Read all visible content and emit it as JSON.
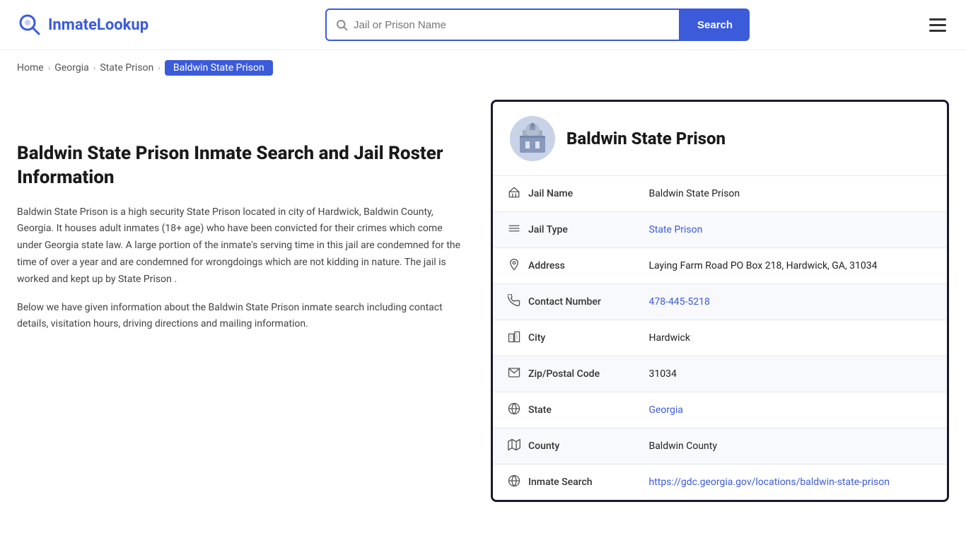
{
  "header": {
    "logo_brand": "InmateLookup",
    "logo_brand_first": "Inmate",
    "logo_brand_second": "Lookup",
    "search_placeholder": "Jail or Prison Name",
    "search_button_label": "Search"
  },
  "breadcrumb": {
    "home": "Home",
    "georgia": "Georgia",
    "state_prison": "State Prison",
    "current": "Baldwin State Prison"
  },
  "left": {
    "page_title": "Baldwin State Prison Inmate Search and Jail Roster Information",
    "description1": "Baldwin State Prison is a high security State Prison located in city of Hardwick, Baldwin County, Georgia. It houses adult inmates (18+ age) who have been convicted for their crimes which come under Georgia state law. A large portion of the inmate's serving time in this jail are condemned for the time of over a year and are condemned for wrongdoings which are not kidding in nature. The jail is worked and kept up by State Prison .",
    "description2": "Below we have given information about the Baldwin State Prison inmate search including contact details, visitation hours, driving directions and mailing information."
  },
  "card": {
    "title": "Baldwin State Prison",
    "rows": [
      {
        "icon": "🏛",
        "label": "Jail Name",
        "value": "Baldwin State Prison",
        "link": false
      },
      {
        "icon": "≡",
        "label": "Jail Type",
        "value": "State Prison",
        "link": true,
        "href": "#"
      },
      {
        "icon": "📍",
        "label": "Address",
        "value": "Laying Farm Road PO Box 218, Hardwick, GA, 31034",
        "link": false
      },
      {
        "icon": "📞",
        "label": "Contact Number",
        "value": "478-445-5218",
        "link": true,
        "href": "tel:4784455218"
      },
      {
        "icon": "🏙",
        "label": "City",
        "value": "Hardwick",
        "link": false
      },
      {
        "icon": "✉",
        "label": "Zip/Postal Code",
        "value": "31034",
        "link": false
      },
      {
        "icon": "🌐",
        "label": "State",
        "value": "Georgia",
        "link": true,
        "href": "#"
      },
      {
        "icon": "🗺",
        "label": "County",
        "value": "Baldwin County",
        "link": false
      },
      {
        "icon": "🌐",
        "label": "Inmate Search",
        "value": "https://gdc.georgia.gov/locations/baldwin-state-prison",
        "link": true,
        "href": "https://gdc.georgia.gov/locations/baldwin-state-prison"
      }
    ]
  },
  "icons": {
    "search": "🔍",
    "hamburger": "☰"
  }
}
